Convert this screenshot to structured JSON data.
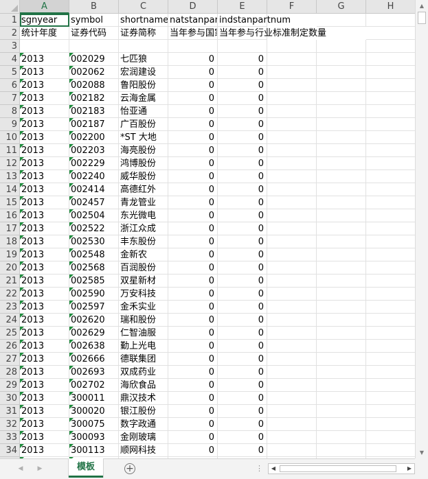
{
  "columns": [
    "A",
    "B",
    "C",
    "D",
    "E",
    "F",
    "G",
    "H"
  ],
  "active_column": "A",
  "header_row": [
    "sgnyear",
    "symbol",
    "shortname",
    "natstanpartnum",
    "indstanpartnum"
  ],
  "label_row": [
    "统计年度",
    "证券代码",
    "证券简称",
    "当年参与国家标准制定数量",
    "当年参与行业标准制定数量"
  ],
  "rows": [
    {
      "n": "4",
      "year": "2013",
      "code": "002029",
      "name": "七匹狼",
      "nat": "0",
      "ind": "0"
    },
    {
      "n": "5",
      "year": "2013",
      "code": "002062",
      "name": "宏润建设",
      "nat": "0",
      "ind": "0"
    },
    {
      "n": "6",
      "year": "2013",
      "code": "002088",
      "name": "鲁阳股份",
      "nat": "0",
      "ind": "0"
    },
    {
      "n": "7",
      "year": "2013",
      "code": "002182",
      "name": "云海金属",
      "nat": "0",
      "ind": "0"
    },
    {
      "n": "8",
      "year": "2013",
      "code": "002183",
      "name": "怡亚通",
      "nat": "0",
      "ind": "0"
    },
    {
      "n": "9",
      "year": "2013",
      "code": "002187",
      "name": "广百股份",
      "nat": "0",
      "ind": "0"
    },
    {
      "n": "10",
      "year": "2013",
      "code": "002200",
      "name": "*ST 大地",
      "nat": "0",
      "ind": "0"
    },
    {
      "n": "11",
      "year": "2013",
      "code": "002203",
      "name": "海亮股份",
      "nat": "0",
      "ind": "0"
    },
    {
      "n": "12",
      "year": "2013",
      "code": "002229",
      "name": "鸿博股份",
      "nat": "0",
      "ind": "0"
    },
    {
      "n": "13",
      "year": "2013",
      "code": "002240",
      "name": "威华股份",
      "nat": "0",
      "ind": "0"
    },
    {
      "n": "14",
      "year": "2013",
      "code": "002414",
      "name": "高德红外",
      "nat": "0",
      "ind": "0"
    },
    {
      "n": "15",
      "year": "2013",
      "code": "002457",
      "name": "青龙管业",
      "nat": "0",
      "ind": "0"
    },
    {
      "n": "16",
      "year": "2013",
      "code": "002504",
      "name": "东光微电",
      "nat": "0",
      "ind": "0"
    },
    {
      "n": "17",
      "year": "2013",
      "code": "002522",
      "name": "浙江众成",
      "nat": "0",
      "ind": "0"
    },
    {
      "n": "18",
      "year": "2013",
      "code": "002530",
      "name": "丰东股份",
      "nat": "0",
      "ind": "0"
    },
    {
      "n": "19",
      "year": "2013",
      "code": "002548",
      "name": "金新农",
      "nat": "0",
      "ind": "0"
    },
    {
      "n": "20",
      "year": "2013",
      "code": "002568",
      "name": "百润股份",
      "nat": "0",
      "ind": "0"
    },
    {
      "n": "21",
      "year": "2013",
      "code": "002585",
      "name": "双星新材",
      "nat": "0",
      "ind": "0"
    },
    {
      "n": "22",
      "year": "2013",
      "code": "002590",
      "name": "万安科技",
      "nat": "0",
      "ind": "0"
    },
    {
      "n": "23",
      "year": "2013",
      "code": "002597",
      "name": "金禾实业",
      "nat": "0",
      "ind": "0"
    },
    {
      "n": "24",
      "year": "2013",
      "code": "002620",
      "name": "瑞和股份",
      "nat": "0",
      "ind": "0"
    },
    {
      "n": "25",
      "year": "2013",
      "code": "002629",
      "name": "仁智油服",
      "nat": "0",
      "ind": "0"
    },
    {
      "n": "26",
      "year": "2013",
      "code": "002638",
      "name": "勤上光电",
      "nat": "0",
      "ind": "0"
    },
    {
      "n": "27",
      "year": "2013",
      "code": "002666",
      "name": "德联集团",
      "nat": "0",
      "ind": "0"
    },
    {
      "n": "28",
      "year": "2013",
      "code": "002693",
      "name": "双成药业",
      "nat": "0",
      "ind": "0"
    },
    {
      "n": "29",
      "year": "2013",
      "code": "002702",
      "name": "海欣食品",
      "nat": "0",
      "ind": "0"
    },
    {
      "n": "30",
      "year": "2013",
      "code": "300011",
      "name": "鼎汉技术",
      "nat": "0",
      "ind": "0"
    },
    {
      "n": "31",
      "year": "2013",
      "code": "300020",
      "name": "银江股份",
      "nat": "0",
      "ind": "0"
    },
    {
      "n": "32",
      "year": "2013",
      "code": "300075",
      "name": "数字政通",
      "nat": "0",
      "ind": "0"
    },
    {
      "n": "33",
      "year": "2013",
      "code": "300093",
      "name": "金刚玻璃",
      "nat": "0",
      "ind": "0"
    },
    {
      "n": "34",
      "year": "2013",
      "code": "300113",
      "name": "顺网科技",
      "nat": "0",
      "ind": "0"
    }
  ],
  "sheet_tab": "模板",
  "icons": {
    "add_sheet": "plus-circle-icon",
    "nav_prev": "triangle-left-icon",
    "nav_next": "triangle-right-icon",
    "scroll_up": "triangle-up-icon",
    "scroll_down": "triangle-down-icon",
    "scroll_left": "triangle-left-icon",
    "scroll_right": "triangle-right-icon"
  },
  "colors": {
    "accent": "#217346",
    "error_indicator": "#1e8c3c"
  }
}
